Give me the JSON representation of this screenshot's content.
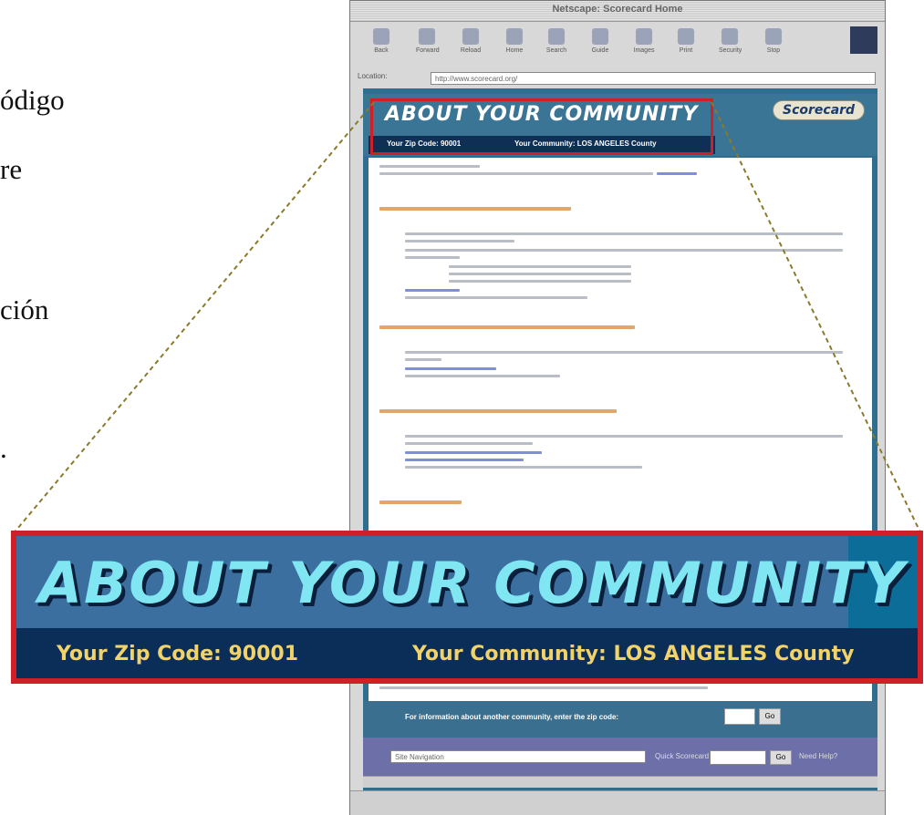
{
  "slide": {
    "fragments": [
      "ódigo",
      "re",
      "ción",
      "."
    ]
  },
  "browser": {
    "title": "Netscape: Scorecard Home",
    "toolbar": [
      {
        "label": "Back",
        "icon": "back-arrow-icon"
      },
      {
        "label": "Forward",
        "icon": "forward-arrow-icon"
      },
      {
        "label": "Reload",
        "icon": "reload-icon"
      },
      {
        "label": "Home",
        "icon": "home-icon"
      },
      {
        "label": "Search",
        "icon": "search-icon"
      },
      {
        "label": "Guide",
        "icon": "guide-icon"
      },
      {
        "label": "Images",
        "icon": "images-icon"
      },
      {
        "label": "Print",
        "icon": "print-icon"
      },
      {
        "label": "Security",
        "icon": "security-icon"
      },
      {
        "label": "Stop",
        "icon": "stop-icon"
      }
    ],
    "location_label": "Location:",
    "location_url": "http://www.scorecard.org/"
  },
  "page": {
    "banner_title": "ABOUT YOUR COMMUNITY",
    "scorecard_label": "Scorecard",
    "zip_label": "Your Zip Code: 90001",
    "community_label": "Your Community: LOS ANGELES County",
    "footer_prompt": "For information about another community, enter the zip code:",
    "footer_go": "Go",
    "nav_select": "Site Navigation",
    "nav_zip_label": "Quick Scorecard",
    "nav_go": "Go",
    "nav_help": "Need Help?"
  },
  "zoom": {
    "title": "ABOUT YOUR COMMUNITY",
    "zip": "Your Zip Code: 90001",
    "community": "Your Community: LOS ANGELES County"
  },
  "colors": {
    "highlight_red": "#cf2027",
    "banner_text": "#7fe6f2",
    "info_text": "#f2d36a",
    "dark_navy": "#0b2e59"
  }
}
